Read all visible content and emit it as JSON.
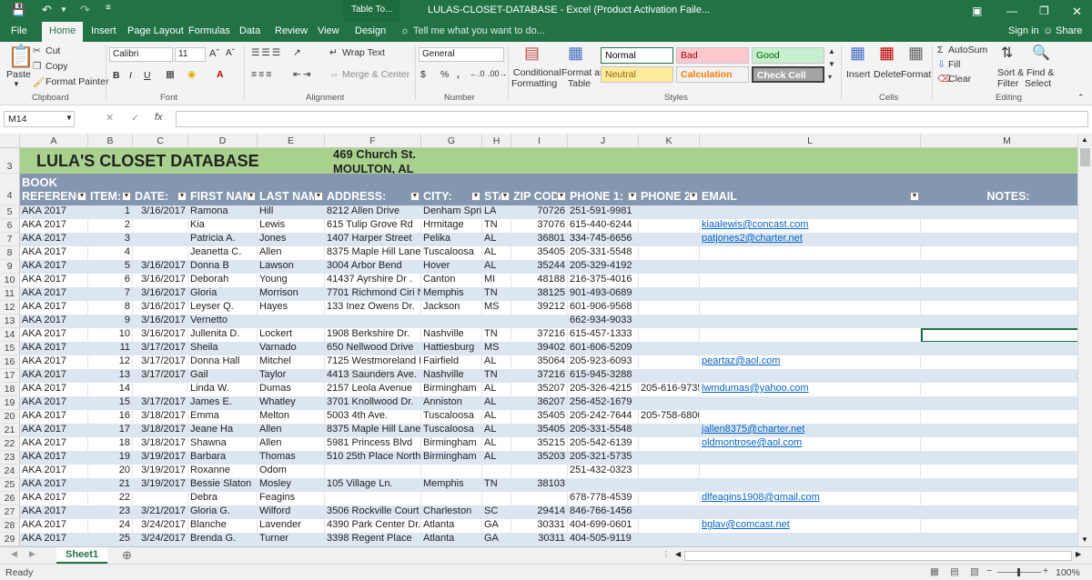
{
  "titlebar": {
    "context_tab": "Table To...",
    "title": "LULAS-CLOSET-DATABASE - Excel (Product Activation Faile...",
    "save_icon": "save-icon",
    "undo_icon": "undo-icon",
    "redo_icon": "redo-icon"
  },
  "tabs": [
    "File",
    "Home",
    "Insert",
    "Page Layout",
    "Formulas",
    "Data",
    "Review",
    "View",
    "Design"
  ],
  "tell_me": "Tell me what you want to do...",
  "sign_in": "Sign in",
  "share": "Share",
  "ribbon": {
    "clipboard": {
      "paste": "Paste",
      "cut": "Cut",
      "copy": "Copy",
      "format_painter": "Format Painter",
      "label": "Clipboard"
    },
    "font": {
      "name": "Calibri",
      "size": "11",
      "label": "Font",
      "bold": "B",
      "italic": "I",
      "underline": "U"
    },
    "alignment": {
      "wrap": "Wrap Text",
      "merge": "Merge & Center",
      "label": "Alignment"
    },
    "number": {
      "format": "General",
      "label": "Number",
      "currency": "$",
      "percent": "%",
      "comma": ","
    },
    "styles": {
      "conditional": "Conditional",
      "conditional2": "Formatting",
      "format_as": "Format as",
      "format_as2": "Table",
      "cells": [
        {
          "label": "Normal",
          "bg": "#ffffff",
          "fg": "#000000"
        },
        {
          "label": "Bad",
          "bg": "#ffc7ce",
          "fg": "#9c0006"
        },
        {
          "label": "Good",
          "bg": "#c6efce",
          "fg": "#006100"
        },
        {
          "label": "Neutral",
          "bg": "#ffeb9c",
          "fg": "#9c6500"
        },
        {
          "label": "Calculation",
          "bg": "#f2f2f2",
          "fg": "#fa7d00"
        },
        {
          "label": "Check Cell",
          "bg": "#a5a5a5",
          "fg": "#ffffff"
        }
      ],
      "label": "Styles"
    },
    "cells": {
      "insert": "Insert",
      "delete": "Delete",
      "format": "Format",
      "label": "Cells"
    },
    "editing": {
      "autosum": "AutoSum",
      "fill": "Fill",
      "clear": "Clear",
      "sort": "Sort &",
      "sort2": "Filter",
      "find": "Find &",
      "find2": "Select",
      "label": "Editing"
    }
  },
  "namebox": "M14",
  "fx": "fx",
  "columns": [
    "A",
    "B",
    "C",
    "D",
    "E",
    "F",
    "G",
    "H",
    "I",
    "J",
    "K",
    "L",
    "M"
  ],
  "banner": {
    "row": "3",
    "title": "LULA'S CLOSET DATABASE",
    "addr1": "469 Church St.",
    "addr2": "MOULTON, AL"
  },
  "header_row": {
    "row": "4",
    "top": "BOOK",
    "cells": [
      "REFERENC",
      "ITEM:",
      "DATE:",
      "FIRST NAM",
      "LAST NAM",
      "ADDRESS:",
      "CITY:",
      "STA",
      "ZIP COD",
      "PHONE 1:",
      "PHONE 2",
      "EMAIL",
      "NOTES:"
    ]
  },
  "rows": [
    {
      "n": "5",
      "c": [
        "AKA 2017",
        "1",
        "3/16/2017",
        "Ramona",
        "Hill",
        "8212 Allen Drive",
        "Denham Spring",
        "LA",
        "70726",
        "251-591-9981",
        "",
        "",
        ""
      ]
    },
    {
      "n": "6",
      "c": [
        "AKA 2017",
        "2",
        "",
        "Kia",
        "Lewis",
        "615 Tulip Grove Rd",
        "Hrmitage",
        "TN",
        "37076",
        "615-440-6244",
        "",
        "kiaalewis@concast.com",
        ""
      ]
    },
    {
      "n": "7",
      "c": [
        "AKA 2017",
        "3",
        "",
        "Patricia A.",
        "Jones",
        "1407 Harper Street",
        "Pelika",
        "AL",
        "36801",
        "334-745-6656",
        "",
        "patjones2@charter.net",
        ""
      ]
    },
    {
      "n": "8",
      "c": [
        "AKA 2017",
        "4",
        "",
        "Jeanetta C.",
        "Allen",
        "8375 Maple Hill Lane",
        "Tuscaloosa",
        "AL",
        "35405",
        "205-331-5548",
        "",
        "",
        ""
      ]
    },
    {
      "n": "9",
      "c": [
        "AKA 2017",
        "5",
        "3/16/2017",
        "Donna B",
        "Lawson",
        "3004 Arbor Bend",
        "Hover",
        "AL",
        "35244",
        "205-329-4192",
        "",
        "",
        ""
      ]
    },
    {
      "n": "10",
      "c": [
        "AKA 2017",
        "6",
        "3/16/2017",
        "Deborah",
        "Young",
        "41437 Ayrshire Dr .",
        "Canton",
        "MI",
        "48188",
        "216-375-4016",
        "",
        "",
        ""
      ]
    },
    {
      "n": "11",
      "c": [
        "AKA 2017",
        "7",
        "3/16/2017",
        "Gloria",
        "Morrison",
        "7701 Richmond Ciri N.",
        "Memphis",
        "TN",
        "38125",
        "901-493-0689",
        "",
        "",
        ""
      ]
    },
    {
      "n": "12",
      "c": [
        "AKA 2017",
        "8",
        "3/16/2017",
        "Leyser Q.",
        "Hayes",
        "133 Inez Owens Dr.",
        "Jackson",
        "MS",
        "39212",
        "601-906-9568",
        "",
        "",
        ""
      ]
    },
    {
      "n": "13",
      "c": [
        "AKA 2017",
        "9",
        "3/16/2017",
        "Vernetto",
        "",
        "",
        "",
        "",
        "",
        "662-934-9033",
        "",
        "",
        ""
      ]
    },
    {
      "n": "14",
      "c": [
        "AKA 2017",
        "10",
        "3/16/2017",
        "Jullenita D.",
        "Lockert",
        "1908 Berkshire Dr.",
        "Nashville",
        "TN",
        "37216",
        "615-457-1333",
        "",
        "",
        ""
      ]
    },
    {
      "n": "15",
      "c": [
        "AKA 2017",
        "11",
        "3/17/2017",
        "Sheila",
        "Varnado",
        "650 Nellwood Drive",
        "Hattiesburg",
        "MS",
        "39402",
        "601-606-5209",
        "",
        "",
        ""
      ]
    },
    {
      "n": "16",
      "c": [
        "AKA 2017",
        "12",
        "3/17/2017",
        "Donna Hall",
        "Mitchel",
        "7125 Westmoreland D",
        "Fairfield",
        "AL",
        "35064",
        "205-923-6093",
        "",
        "peartaz@aol.com",
        ""
      ]
    },
    {
      "n": "17",
      "c": [
        "AKA 2017",
        "13",
        "3/17/2017",
        "Gail",
        "Taylor",
        "4413 Saunders Ave.",
        "Nashville",
        "TN",
        "37216",
        "615-945-3288",
        "",
        "",
        ""
      ]
    },
    {
      "n": "18",
      "c": [
        "AKA 2017",
        "14",
        "",
        "Linda W.",
        "Dumas",
        "2157 Leola Avenue",
        "Birmingham",
        "AL",
        "35207",
        "205-326-4215",
        "205-616-9735",
        "lwmdumas@yahoo.com",
        ""
      ]
    },
    {
      "n": "19",
      "c": [
        "AKA 2017",
        "15",
        "3/17/2017",
        "James E.",
        "Whatley",
        "3701 Knollwood Dr.",
        "Anniston",
        "AL",
        "36207",
        "256-452-1679",
        "",
        "",
        ""
      ]
    },
    {
      "n": "20",
      "c": [
        "AKA 2017",
        "16",
        "3/18/2017",
        "Emma",
        "Melton",
        "5003 4th Ave.",
        "Tuscaloosa",
        "AL",
        "35405",
        "205-242-7644",
        "205-758-6800",
        "",
        ""
      ]
    },
    {
      "n": "21",
      "c": [
        "AKA 2017",
        "17",
        "3/18/2017",
        "Jeane Ha",
        "Allen",
        "8375 Maple Hill Lane",
        "Tuscaloosa",
        "AL",
        "35405",
        "205-331-5548",
        "",
        "jallen8375@charter.net",
        ""
      ]
    },
    {
      "n": "22",
      "c": [
        "AKA 2017",
        "18",
        "3/18/2017",
        "Shawna",
        "Allen",
        "5981 Princess Blvd",
        "Birmingham",
        "AL",
        "35215",
        "205-542-6139",
        "",
        "oldmontrose@aol.com",
        ""
      ]
    },
    {
      "n": "23",
      "c": [
        "AKA 2017",
        "19",
        "3/19/2017",
        "Barbara",
        "Thomas",
        "510 25th Place North",
        "Birmingham",
        "AL",
        "35203",
        "205-321-5735",
        "",
        "",
        ""
      ]
    },
    {
      "n": "24",
      "c": [
        "AKA 2017",
        "20",
        "3/19/2017",
        "Roxanne",
        "Odom",
        "",
        "",
        "",
        "",
        "251-432-0323",
        "",
        "",
        ""
      ]
    },
    {
      "n": "25",
      "c": [
        "AKA 2017",
        "21",
        "3/19/2017",
        "Bessie Slaton",
        "Mosley",
        "105 Village Ln.",
        "Memphis",
        "TN",
        "38103",
        "",
        "",
        "",
        ""
      ]
    },
    {
      "n": "26",
      "c": [
        "AKA 2017",
        "22",
        "",
        "Debra",
        "Feagins",
        "",
        "",
        "",
        "",
        "678-778-4539",
        "",
        "dlfeagins1908@gmail.com",
        ""
      ]
    },
    {
      "n": "27",
      "c": [
        "AKA 2017",
        "23",
        "3/21/2017",
        "Gloria G.",
        "Wilford",
        "3506 Rockville Court",
        "Charleston",
        "SC",
        "29414",
        "846-766-1456",
        "",
        "",
        ""
      ]
    },
    {
      "n": "28",
      "c": [
        "AKA 2017",
        "24",
        "3/24/2017",
        "Blanche",
        "Lavender",
        "4390 Park Center Dr.",
        "Atlanta",
        "GA",
        "30331",
        "404-699-0601",
        "",
        "bglav@comcast.net",
        ""
      ]
    },
    {
      "n": "29",
      "c": [
        "AKA 2017",
        "25",
        "3/24/2017",
        "Brenda G.",
        "Turner",
        "3398 Regent Place",
        "Atlanta",
        "GA",
        "30311",
        "404-505-9119",
        "",
        "",
        ""
      ]
    }
  ],
  "sheet_tab": "Sheet1",
  "status": "Ready",
  "zoom": "100%",
  "colors": {
    "excel_green": "#217346",
    "banner": "#a9d18e",
    "header": "#8497b0",
    "band": "#dce6f1"
  }
}
